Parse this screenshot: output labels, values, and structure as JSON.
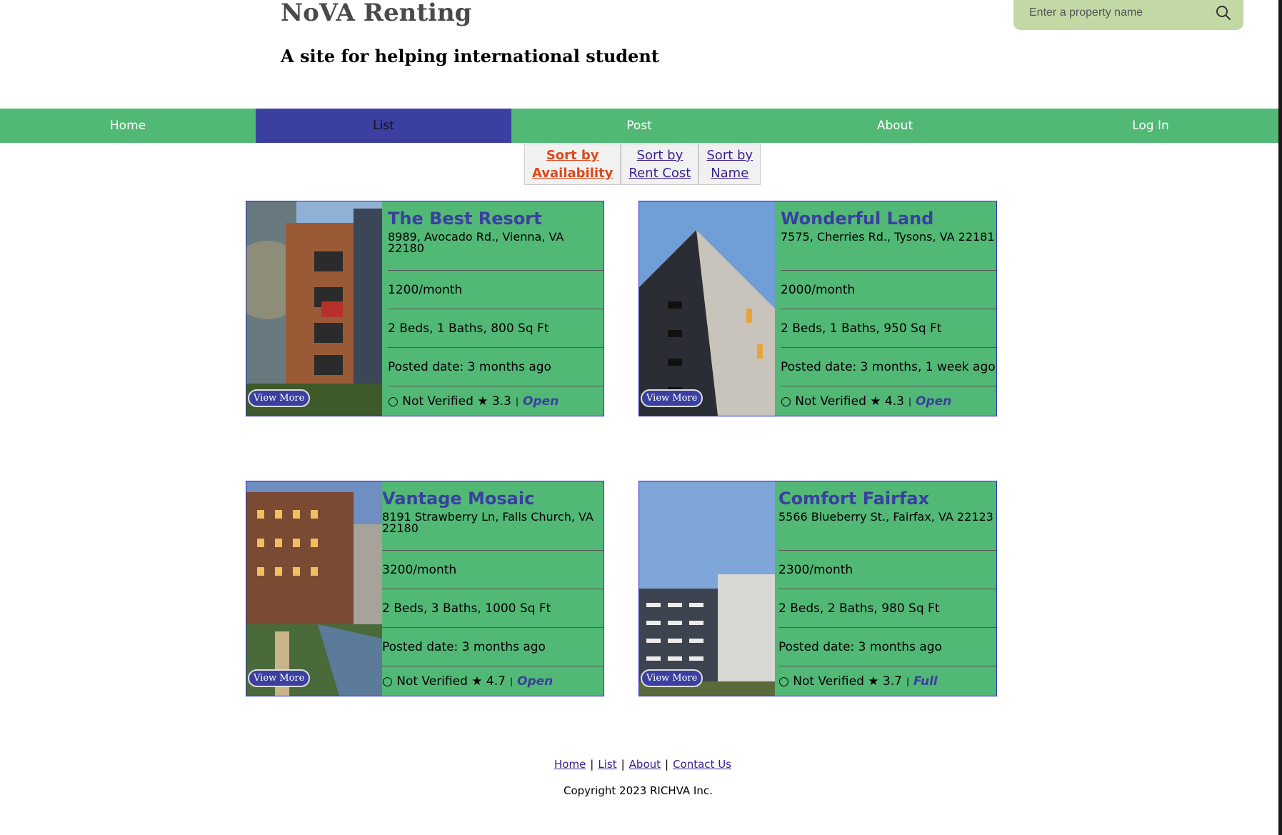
{
  "header": {
    "title": "NoVA Renting",
    "subtitle": "A site for helping international student",
    "search_placeholder": "Enter a property name"
  },
  "nav": {
    "items": [
      "Home",
      "List",
      "Post",
      "About",
      "Log In"
    ],
    "active": "List"
  },
  "sort": {
    "availability": [
      "Sort by",
      "Availability"
    ],
    "rent": [
      "Sort by",
      "Rent Cost"
    ],
    "name": [
      "Sort by",
      "Name"
    ]
  },
  "listings": [
    {
      "name": "The Best Resort",
      "address": "8989, Avocado Rd., Vienna, VA 22180",
      "rent": "1200/month",
      "details": "2 Beds, 1 Baths, 800 Sq Ft",
      "posted": "Posted date: 3 months ago",
      "verified": "○ Not Verified",
      "rating": "★ 3.3",
      "availability": "Open",
      "button": "View More"
    },
    {
      "name": "Wonderful Land",
      "address": "7575, Cherries Rd., Tysons, VA 22181",
      "rent": "2000/month",
      "details": "2 Beds, 1 Baths, 950 Sq Ft",
      "posted": "Posted date: 3 months, 1 week ago",
      "verified": "○ Not Verified",
      "rating": "★ 4.3",
      "availability": "Open",
      "button": "View More"
    },
    {
      "name": "Vantage Mosaic",
      "address": "8191 Strawberry Ln, Falls Church, VA 22180",
      "rent": "3200/month",
      "details": "2 Beds, 3 Baths, 1000 Sq Ft",
      "posted": "Posted date: 3 months ago",
      "verified": "○ Not Verified",
      "rating": "★ 4.7",
      "availability": "Open",
      "button": "View More"
    },
    {
      "name": "Comfort Fairfax",
      "address": "5566 Blueberry St., Fairfax, VA 22123",
      "rent": "2300/month",
      "details": "2 Beds, 2 Baths, 980 Sq Ft",
      "posted": "Posted date: 3 months ago",
      "verified": "○ Not Verified",
      "rating": "★ 3.7",
      "availability": "Full",
      "button": "View More"
    }
  ],
  "footer": {
    "links": [
      "Home",
      "List",
      "About",
      "Contact Us"
    ],
    "separator": "|",
    "copyright": "Copyright 2023 RICHVA Inc."
  },
  "colors": {
    "nav_green": "#52b876",
    "nav_active": "#3a3fa0",
    "search_bg": "#c2d9a6",
    "title_blue": "#3a3fa0",
    "sort_active": "#e0481a"
  }
}
